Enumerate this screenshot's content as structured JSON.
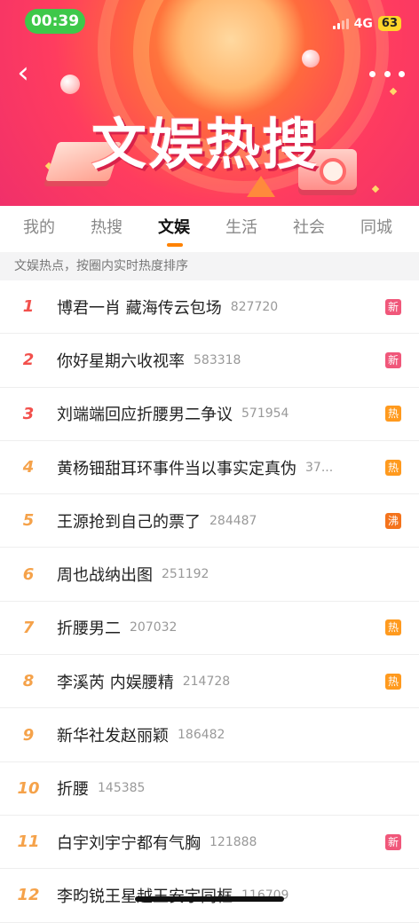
{
  "status_bar": {
    "time": "00:39",
    "network": "4G",
    "battery": "63"
  },
  "banner": {
    "title": "文娱热搜"
  },
  "tabs": [
    {
      "label": "我的",
      "active": false
    },
    {
      "label": "热搜",
      "active": false
    },
    {
      "label": "文娱",
      "active": true
    },
    {
      "label": "生活",
      "active": false
    },
    {
      "label": "社会",
      "active": false
    },
    {
      "label": "同城",
      "active": false
    }
  ],
  "subheader": "文娱热点，按圈内实时热度排序",
  "colors": {
    "new": "#f0577a",
    "hot": "#ff9a1e",
    "boil": "#f4731c",
    "accent": "#ff8200"
  },
  "items": [
    {
      "rank": "1",
      "title": "博君一肖 藏海传云包场",
      "count": "827720",
      "badge": "新",
      "badge_type": "new"
    },
    {
      "rank": "2",
      "title": "你好星期六收视率",
      "count": "583318",
      "badge": "新",
      "badge_type": "new"
    },
    {
      "rank": "3",
      "title": "刘端端回应折腰男二争议",
      "count": "571954",
      "badge": "热",
      "badge_type": "hot"
    },
    {
      "rank": "4",
      "title": "黄杨钿甜耳环事件当以事实定真伪",
      "count": "37...",
      "badge": "热",
      "badge_type": "hot"
    },
    {
      "rank": "5",
      "title": "王源抢到自己的票了",
      "count": "284487",
      "badge": "沸",
      "badge_type": "boil"
    },
    {
      "rank": "6",
      "title": "周也战纳出图",
      "count": "251192",
      "badge": "",
      "badge_type": ""
    },
    {
      "rank": "7",
      "title": "折腰男二",
      "count": "207032",
      "badge": "热",
      "badge_type": "hot"
    },
    {
      "rank": "8",
      "title": "李溪芮 内娱腰精",
      "count": "214728",
      "badge": "热",
      "badge_type": "hot"
    },
    {
      "rank": "9",
      "title": "新华社发赵丽颖",
      "count": "186482",
      "badge": "",
      "badge_type": ""
    },
    {
      "rank": "10",
      "title": "折腰",
      "count": "145385",
      "badge": "",
      "badge_type": ""
    },
    {
      "rank": "11",
      "title": "白宇刘宇宁都有气胸",
      "count": "121888",
      "badge": "新",
      "badge_type": "new"
    },
    {
      "rank": "12",
      "title": "李昀锐王星越王安宇同框",
      "count": "116709",
      "badge": "",
      "badge_type": ""
    }
  ]
}
